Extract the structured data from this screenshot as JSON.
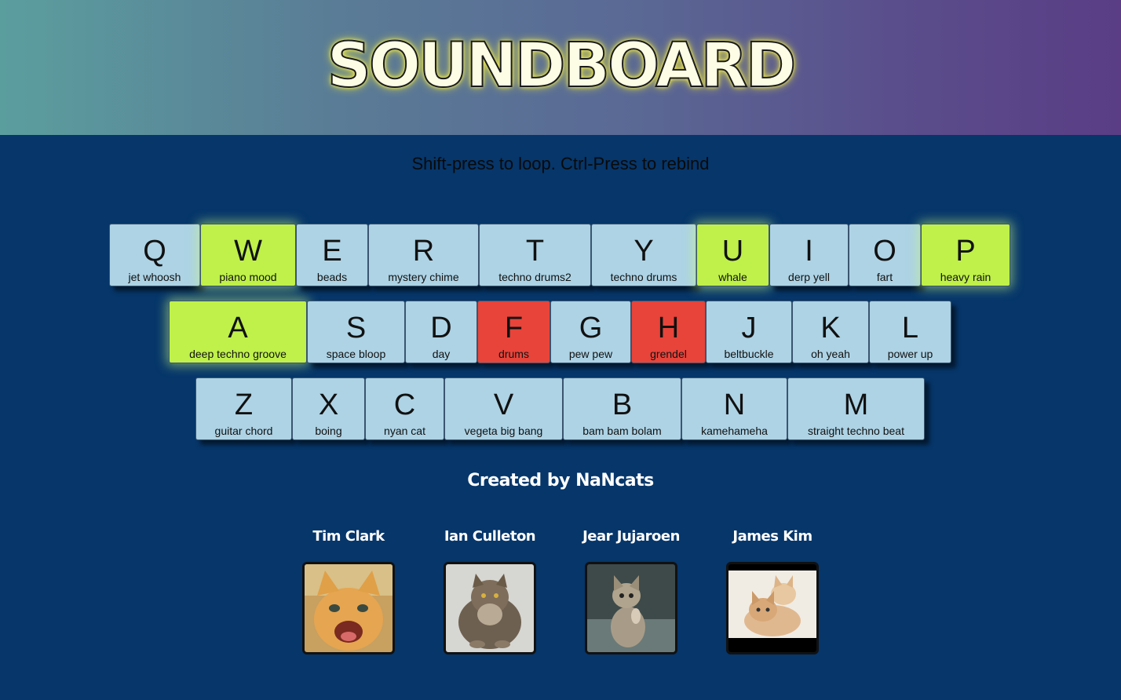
{
  "header": {
    "title": "SOUNDBOARD"
  },
  "instructions": "Shift-press to loop. Ctrl-Press to rebind",
  "keyboard": {
    "rows": [
      [
        {
          "letter": "Q",
          "sound": "jet whoosh",
          "state": "idle"
        },
        {
          "letter": "W",
          "sound": "piano mood",
          "state": "looping"
        },
        {
          "letter": "E",
          "sound": "beads",
          "state": "idle"
        },
        {
          "letter": "R",
          "sound": "mystery chime",
          "state": "idle"
        },
        {
          "letter": "T",
          "sound": "techno drums2",
          "state": "idle"
        },
        {
          "letter": "Y",
          "sound": "techno drums",
          "state": "idle"
        },
        {
          "letter": "U",
          "sound": "whale",
          "state": "looping"
        },
        {
          "letter": "I",
          "sound": "derp yell",
          "state": "idle"
        },
        {
          "letter": "O",
          "sound": "fart",
          "state": "idle"
        },
        {
          "letter": "P",
          "sound": "heavy rain",
          "state": "looping"
        }
      ],
      [
        {
          "letter": "A",
          "sound": "deep techno groove",
          "state": "looping"
        },
        {
          "letter": "S",
          "sound": "space bloop",
          "state": "idle"
        },
        {
          "letter": "D",
          "sound": "day",
          "state": "idle"
        },
        {
          "letter": "F",
          "sound": "drums",
          "state": "playing"
        },
        {
          "letter": "G",
          "sound": "pew pew",
          "state": "idle"
        },
        {
          "letter": "H",
          "sound": "grendel",
          "state": "playing"
        },
        {
          "letter": "J",
          "sound": "beltbuckle",
          "state": "idle"
        },
        {
          "letter": "K",
          "sound": "oh yeah",
          "state": "idle"
        },
        {
          "letter": "L",
          "sound": "power up",
          "state": "idle"
        }
      ],
      [
        {
          "letter": "Z",
          "sound": "guitar chord",
          "state": "idle"
        },
        {
          "letter": "X",
          "sound": "boing",
          "state": "idle"
        },
        {
          "letter": "C",
          "sound": "nyan cat",
          "state": "idle"
        },
        {
          "letter": "V",
          "sound": "vegeta big bang",
          "state": "idle"
        },
        {
          "letter": "B",
          "sound": "bam bam bolam",
          "state": "idle"
        },
        {
          "letter": "N",
          "sound": "kamehameha",
          "state": "idle"
        },
        {
          "letter": "M",
          "sound": "straight techno beat",
          "state": "idle"
        }
      ]
    ]
  },
  "colors": {
    "idle": "#add3e5",
    "looping": "#bff14a",
    "playing": "#e8443a"
  },
  "credits": {
    "heading": "Created by NaNcats",
    "members": [
      {
        "name": "Tim Clark",
        "photo": "orange-kitten-photo"
      },
      {
        "name": "Ian Culleton",
        "photo": "fluffy-grey-cat-photo"
      },
      {
        "name": "Jear Jujaroen",
        "photo": "tabby-kitten-photo"
      },
      {
        "name": "James Kim",
        "photo": "two-kittens-photo"
      }
    ]
  }
}
